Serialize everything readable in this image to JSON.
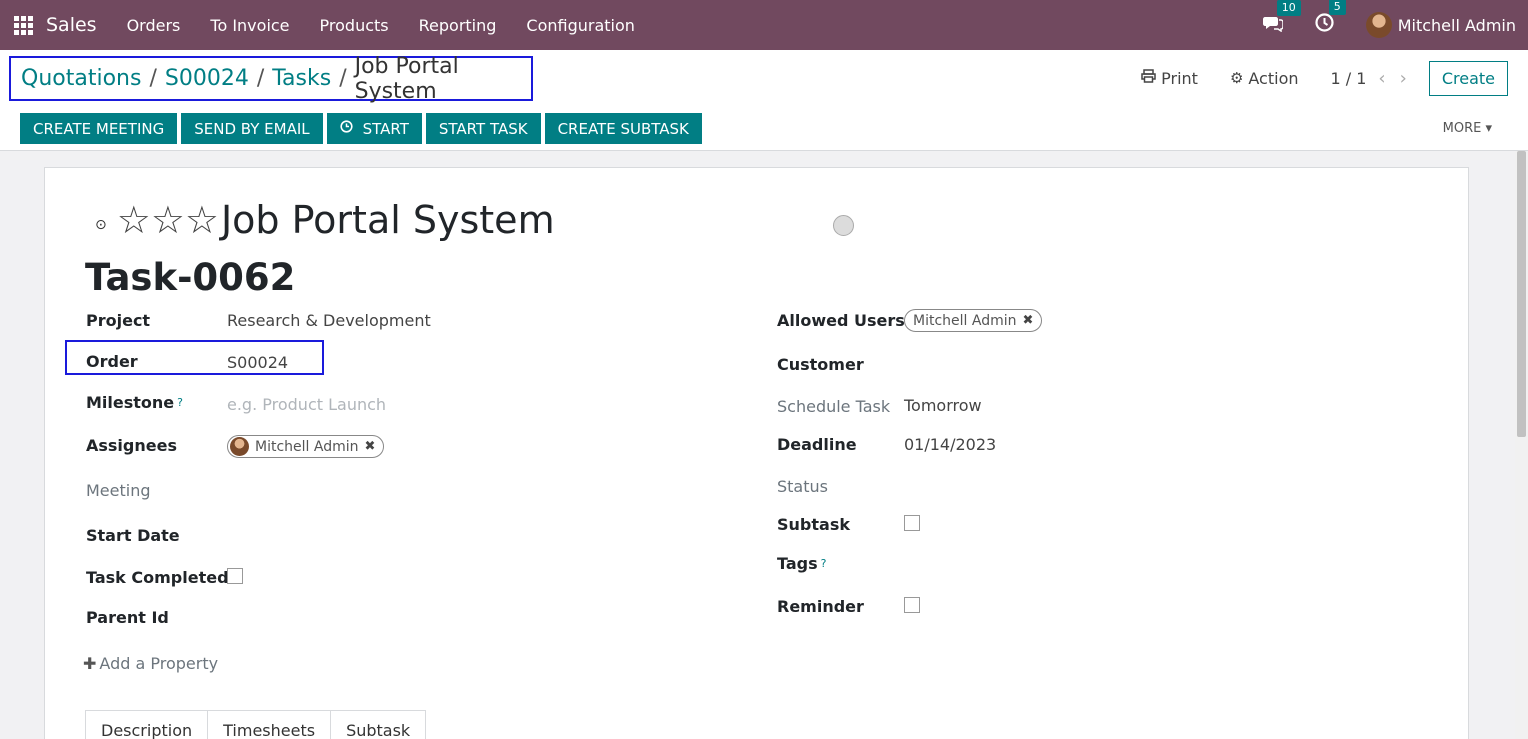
{
  "navbar": {
    "brand": "Sales",
    "menu": [
      "Orders",
      "To Invoice",
      "Products",
      "Reporting",
      "Configuration"
    ],
    "messages_count": "10",
    "activities_count": "5",
    "user_name": "Mitchell Admin",
    "color": "#71495f"
  },
  "breadcrumb": {
    "items": [
      "Quotations",
      "S00024",
      "Tasks"
    ],
    "current": "Job Portal System"
  },
  "control": {
    "print_label": "Print",
    "action_label": "Action",
    "pager": "1 / 1",
    "create_label": "Create",
    "more_label": "MORE",
    "accent": "#017e84"
  },
  "actions": [
    "CREATE MEETING",
    "SEND BY EMAIL",
    "START",
    "START TASK",
    "CREATE SUBTASK"
  ],
  "task": {
    "title": "Job Portal System",
    "number": "Task-0062",
    "stars_filled": 0,
    "stars_total": 3
  },
  "fields_left": {
    "project_label": "Project",
    "project_value": "Research & Development",
    "order_label": "Order",
    "order_value": "S00024",
    "milestone_label": "Milestone",
    "milestone_help": "?",
    "milestone_placeholder": "e.g. Product Launch",
    "assignees_label": "Assignees",
    "assignee_tag": "Mitchell Admin",
    "meeting_label": "Meeting",
    "start_date_label": "Start Date",
    "task_completed_label": "Task Completed",
    "parent_id_label": "Parent Id"
  },
  "fields_right": {
    "allowed_users_label": "Allowed Users",
    "allowed_user_tag": "Mitchell Admin",
    "customer_label": "Customer",
    "schedule_task_label": "Schedule Task",
    "schedule_task_value": "Tomorrow",
    "deadline_label": "Deadline",
    "deadline_value": "01/14/2023",
    "status_label": "Status",
    "subtask_label": "Subtask",
    "tags_label": "Tags",
    "tags_help": "?",
    "reminder_label": "Reminder"
  },
  "add_property": "Add a Property",
  "tabs": [
    "Description",
    "Timesheets",
    "Subtask"
  ]
}
